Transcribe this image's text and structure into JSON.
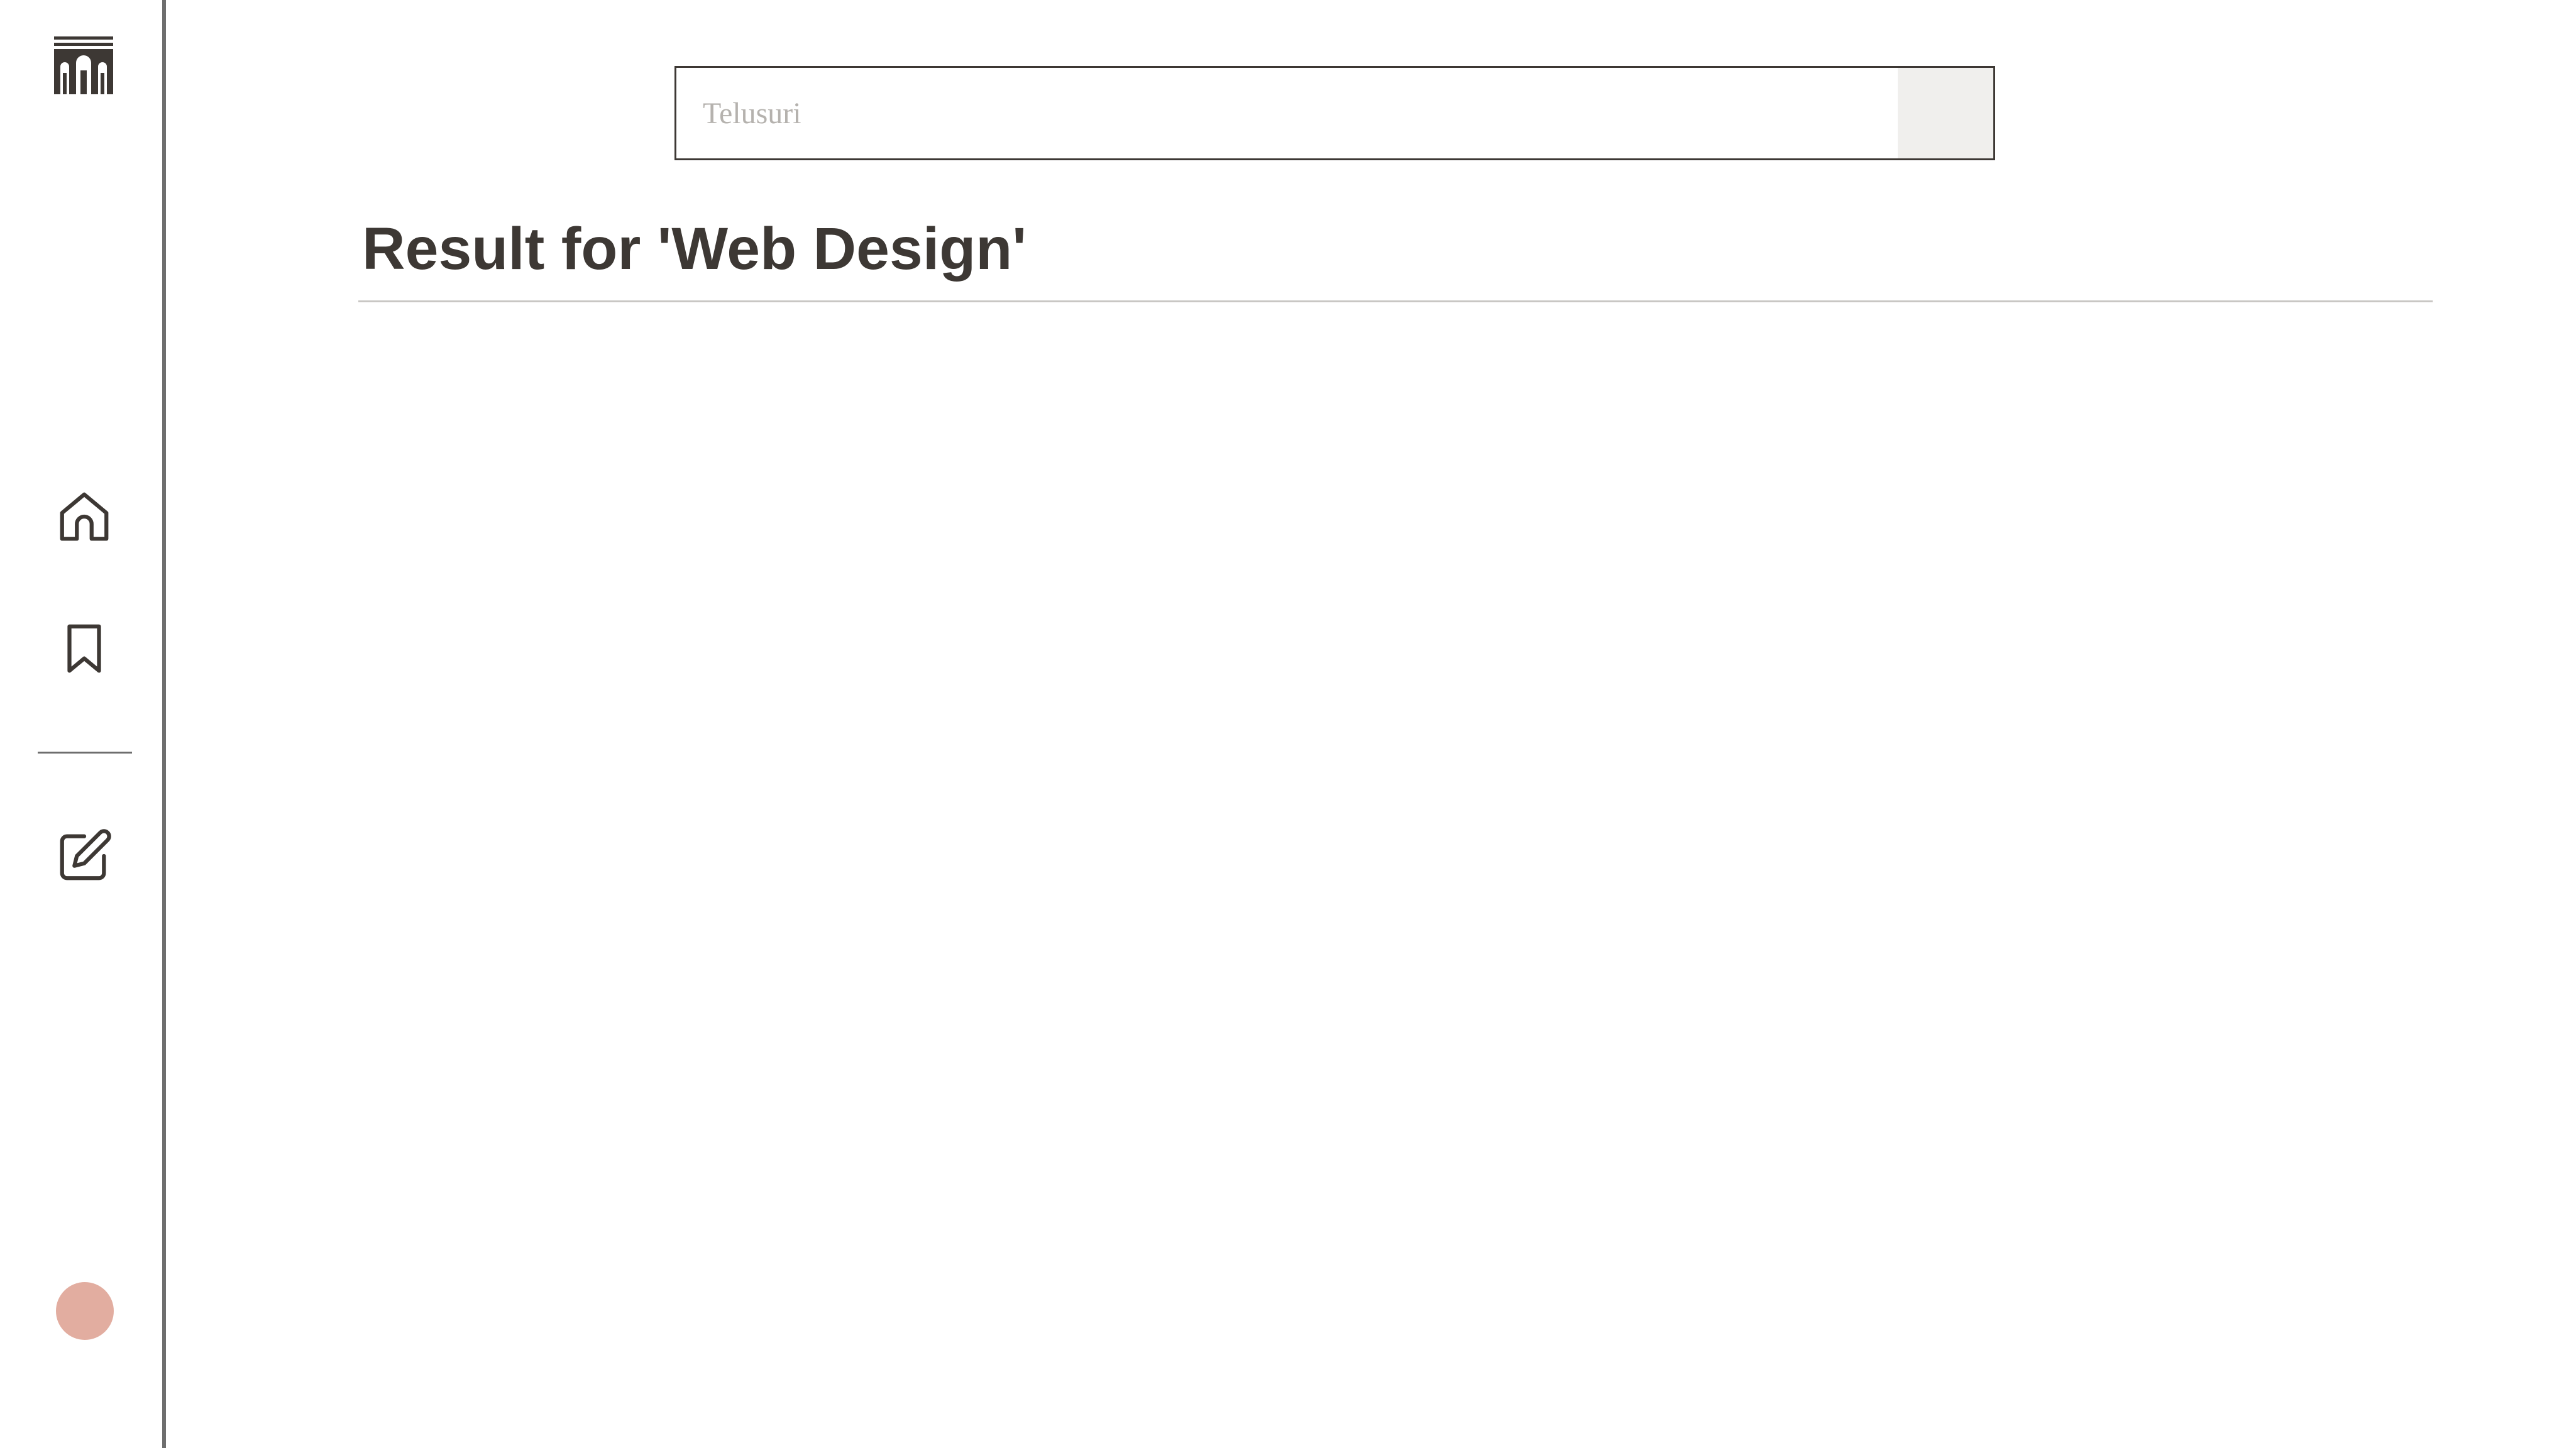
{
  "colors": {
    "text": "#3d3834",
    "sidebar_border": "#6e6e6e",
    "avatar": "#e2ada0",
    "placeholder": "#b5b2ae",
    "search_button_bg": "#f0efed",
    "divider": "#c9c7c4"
  },
  "sidebar": {
    "logo_icon": "building-logo-icon",
    "items": [
      {
        "name": "home",
        "icon": "home-icon"
      },
      {
        "name": "bookmarks",
        "icon": "bookmark-icon"
      },
      {
        "name": "write",
        "icon": "edit-icon"
      }
    ],
    "avatar_icon": "user-avatar"
  },
  "search": {
    "placeholder": "Telusuri",
    "value": ""
  },
  "results": {
    "heading": "Result for 'Web Design'"
  }
}
